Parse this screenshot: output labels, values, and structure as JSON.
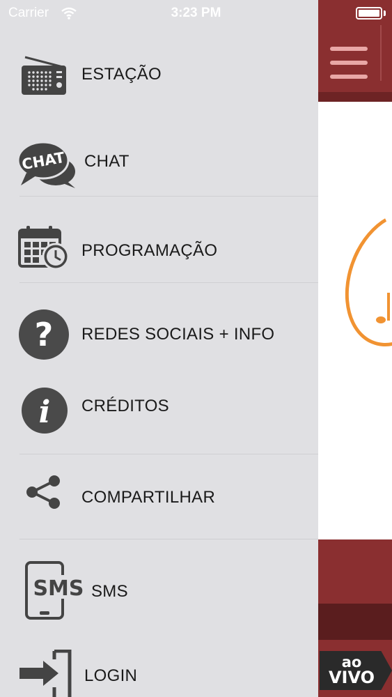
{
  "status_bar": {
    "carrier": "Carrier",
    "time": "3:23 PM"
  },
  "background_app": {
    "header_color": "#8a2f30",
    "badge_line1": "ao",
    "badge_line2": "VIVO",
    "logo_accent": "#f19332"
  },
  "drawer": {
    "background": "#e0e0e3",
    "items": [
      {
        "label": "ESTAÇÃO",
        "icon": "radio-icon"
      },
      {
        "label": "CHAT",
        "icon": "chat-bubble-icon"
      },
      {
        "label": "PROGRAMAÇÃO",
        "icon": "calendar-clock-icon"
      },
      {
        "label": "REDES SOCIAIS + INFO",
        "icon": "question-icon"
      },
      {
        "label": "CRÉDITOS",
        "icon": "info-icon"
      },
      {
        "label": "COMPARTILHAR",
        "icon": "share-icon"
      },
      {
        "label": "SMS",
        "icon": "sms-phone-icon"
      },
      {
        "label": "LOGIN",
        "icon": "login-icon"
      }
    ]
  }
}
